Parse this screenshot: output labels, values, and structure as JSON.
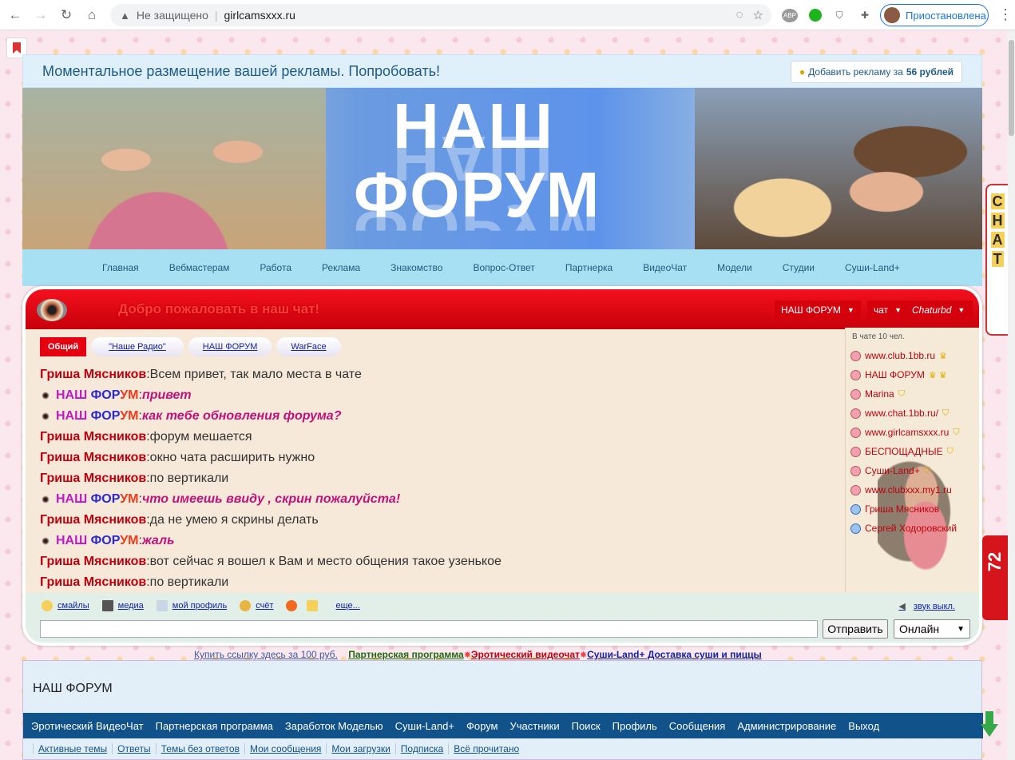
{
  "browser": {
    "security_label": "Не защищено",
    "url": "girlcamsxxx.ru",
    "profile_label": "Приостановлена",
    "ext_abp": "ABP"
  },
  "ad_bar": {
    "text": "Моментальное размещение вашей рекламы. Попробовать!",
    "button_label": "Добавить рекламу за",
    "button_price": "56 рублей"
  },
  "banner": {
    "title_line1": "НАШ",
    "title_line2": "ФОРУМ"
  },
  "topnav": [
    "Главная",
    "Вебмастерам",
    "Работа",
    "Реклама",
    "Знакомство",
    "Вопрос-Ответ",
    "Партнерка",
    "ВидеоЧат",
    "Модели",
    "Студии",
    "Суши-Land+"
  ],
  "chat": {
    "welcome": "Добро пожаловать в наш чат!",
    "header_selects": [
      "НАШ ФОРУМ",
      "чат",
      "Chaturbd"
    ],
    "tabs": [
      "Общий",
      "\"Наше Радио\"",
      "НАШ ФОРУМ",
      "WarFace"
    ],
    "admin_nick_parts": [
      "НАШ ",
      "ФОР",
      "УМ"
    ],
    "messages": [
      {
        "nick": "Гриша Мясников",
        "text": "Всем привет, так мало места в чате",
        "admin": false
      },
      {
        "nick": "НАШ ФОРУМ",
        "text": "привет",
        "admin": true
      },
      {
        "nick": "НАШ ФОРУМ",
        "text": "как тебе обновления форума?",
        "admin": true
      },
      {
        "nick": "Гриша Мясников",
        "text": "форум мешается",
        "admin": false
      },
      {
        "nick": "Гриша Мясников",
        "text": "окно чата расширить нужно",
        "admin": false
      },
      {
        "nick": "Гриша Мясников",
        "text": "по вертикали",
        "admin": false
      },
      {
        "nick": "НАШ ФОРУМ",
        "text": "что имеешь ввиду , скрин пожалуйста!",
        "admin": true
      },
      {
        "nick": "Гриша Мясников",
        "text": "да не умею я скрины делать",
        "admin": false
      },
      {
        "nick": "НАШ ФОРУМ",
        "text": "жаль",
        "admin": true
      },
      {
        "nick": "Гриша Мясников",
        "text": "вот сейчас я вошел к Вам и место общения такое узенькое",
        "admin": false
      },
      {
        "nick": "Гриша Мясников",
        "text": "по вертикали",
        "admin": false
      }
    ],
    "users_count": "В чате 10 чел.",
    "users": [
      {
        "name": "www.club.1bb.ru",
        "gender": "f",
        "badge": "♛"
      },
      {
        "name": "НАШ ФОРУМ",
        "gender": "f",
        "badge": "♛ ♛"
      },
      {
        "name": "Marina",
        "gender": "f",
        "badge": "⛉"
      },
      {
        "name": "www.chat.1bb.ru/",
        "gender": "f",
        "badge": "⛉"
      },
      {
        "name": "www.girlcamsxxx.ru",
        "gender": "f",
        "badge": "⛉"
      },
      {
        "name": "БЕСПОЩАДНЫЕ",
        "gender": "f",
        "badge": "⛉"
      },
      {
        "name": "Суши-Land+",
        "gender": "f",
        "badge": "⛉"
      },
      {
        "name": "www.clubxxx.my1.ru",
        "gender": "f",
        "badge": ""
      },
      {
        "name": "Гриша Мясников",
        "gender": "m",
        "badge": ""
      },
      {
        "name": "Сергей Ходоровский",
        "gender": "m",
        "badge": ""
      }
    ],
    "toolbar": {
      "smileys": "смайлы",
      "media": "медиа",
      "profile": "мой профиль",
      "account": "счёт",
      "more": "еще...",
      "sound": "звук выкл."
    },
    "input": {
      "value": "",
      "send": "Отправить",
      "status": "Онлайн"
    }
  },
  "links_row": {
    "buy_link": "Купить ссылку здесь за 100 руб.",
    "partner": "Партнерская программа",
    "erotic": "Эротический видеочат",
    "sushi": "Суши-Land+ Доставка суши и пиццы"
  },
  "forum": {
    "title": "НАШ ФОРУМ",
    "nav": [
      "Эротический ВидеоЧат",
      "Партнерская программа",
      "Заработок Моделью",
      "Суши-Land+",
      "Форум",
      "Участники",
      "Поиск",
      "Профиль",
      "Сообщения",
      "Администрирование",
      "Выход"
    ],
    "sub": [
      "Активные темы",
      "Ответы",
      "Темы без ответов",
      "Мои сообщения",
      "Мои загрузки",
      "Подписка",
      "Всё прочитано"
    ]
  },
  "side": {
    "chat_letters": [
      "С",
      "Н",
      "А",
      "Т"
    ],
    "counter": "72"
  }
}
